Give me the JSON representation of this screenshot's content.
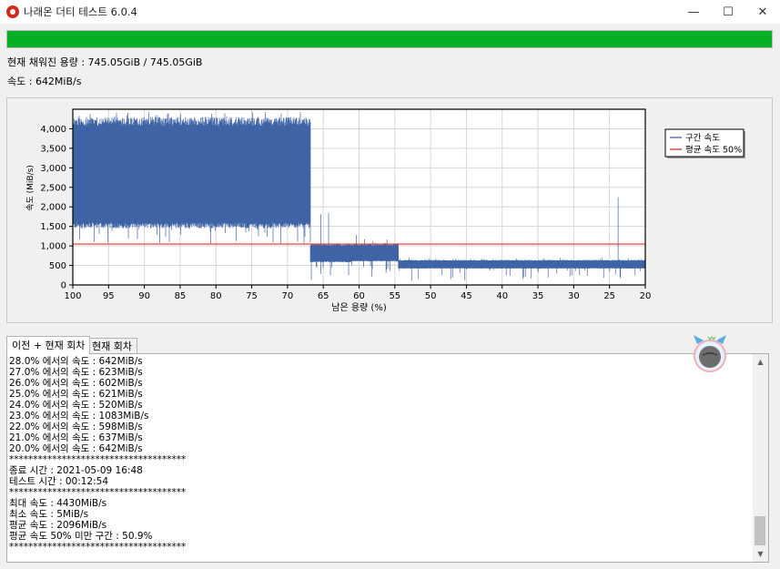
{
  "window": {
    "title": "나래온 더티 테스트 6.0.4",
    "minimize": "—",
    "maximize": "☐",
    "close": "✕"
  },
  "progress": {
    "fraction": 1.0,
    "color": "#06b025"
  },
  "status": {
    "filled": "현재 채워진 용량 : 745.05GiB / 745.05GiB",
    "speed": "속도 : 642MiB/s"
  },
  "chart_data": {
    "type": "line",
    "xlabel": "남은 용량 (%)",
    "ylabel": "속도 (MiB/s)",
    "xlim": [
      100,
      20
    ],
    "ylim": [
      0,
      4500
    ],
    "x_ticks": [
      100,
      95,
      90,
      85,
      80,
      75,
      70,
      65,
      60,
      55,
      50,
      45,
      40,
      35,
      30,
      25,
      20
    ],
    "y_ticks": [
      0,
      500,
      1000,
      1500,
      2000,
      2500,
      3000,
      3500,
      4000
    ],
    "y_tick_labels": [
      "0",
      "500",
      "1,000",
      "1,500",
      "2,000",
      "2,500",
      "3,000",
      "3,500",
      "4,000"
    ],
    "grid": true,
    "legend_position": "top-right",
    "series": [
      {
        "name": "구간 속도",
        "color": "#3f64a6",
        "segments": [
          {
            "x_from": 100,
            "x_to": 66.8,
            "low": 1450,
            "high": 4300,
            "spike_low": 1050,
            "spike_high": 4430
          },
          {
            "x_from": 66.8,
            "x_to": 61,
            "low": 580,
            "high": 1050,
            "spike_low": 100,
            "spike_high": 1900
          },
          {
            "x_from": 61,
            "x_to": 54.5,
            "low": 600,
            "high": 1050,
            "spike_low": 100,
            "spike_high": 1300
          },
          {
            "x_from": 54.5,
            "x_to": 20,
            "low": 420,
            "high": 640,
            "spike_low": 100,
            "spike_high": 700
          }
        ],
        "spike_events": [
          {
            "x": 23.8,
            "y": 2250
          }
        ]
      },
      {
        "name": "평균 속도 50%",
        "color": "#e03030",
        "values": [
          1048,
          1048
        ]
      }
    ]
  },
  "tabs": [
    {
      "label": "이전 + 현재 회차",
      "active": true
    },
    {
      "label": "현재 회차",
      "active": false
    }
  ],
  "log": {
    "lines": [
      "28.0% 에서의 속도 : 642MiB/s",
      "27.0% 에서의 속도 : 623MiB/s",
      "26.0% 에서의 속도 : 602MiB/s",
      "25.0% 에서의 속도 : 621MiB/s",
      "24.0% 에서의 속도 : 520MiB/s",
      "23.0% 에서의 속도 : 1083MiB/s",
      "22.0% 에서의 속도 : 598MiB/s",
      "21.0% 에서의 속도 : 637MiB/s",
      "20.0% 에서의 속도 : 642MiB/s",
      "*************************************",
      "종료 시간 : 2021-05-09 16:48",
      "테스트 시간 : 00:12:54",
      "*************************************",
      "최대 속도 : 4430MiB/s",
      "최소 속도 : 5MiB/s",
      "평균 속도 : 2096MiB/s",
      "평균 속도 50% 미만 구간 : 50.9%",
      "*************************************"
    ]
  },
  "scroll": {
    "up": "▲",
    "down": "▼"
  }
}
